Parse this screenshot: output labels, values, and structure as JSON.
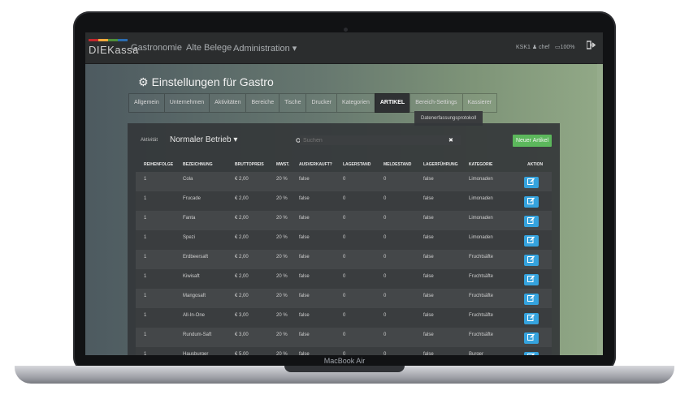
{
  "device": {
    "label": "MacBook Air"
  },
  "navbar": {
    "logo": "DIEKassa",
    "logo_colors": [
      "#c2272d",
      "#f2a93b",
      "#4e8f3a",
      "#2b6cb0"
    ],
    "items": [
      "Gastronomie",
      "Alte Belege",
      "Administration ▾"
    ],
    "user": "KSK1 ♟ chef",
    "battery": "▭100%",
    "logout_icon": "logout-icon"
  },
  "page": {
    "title": "Einstellungen für Gastro"
  },
  "tabs": [
    {
      "label": "Allgemein"
    },
    {
      "label": "Unternehmen"
    },
    {
      "label": "Aktivitäten"
    },
    {
      "label": "Bereiche"
    },
    {
      "label": "Tische"
    },
    {
      "label": "Drucker"
    },
    {
      "label": "Kategorien"
    },
    {
      "label": "ARTIKEL"
    },
    {
      "label": "Bereich-Settings"
    },
    {
      "label": "Kassierer"
    }
  ],
  "subtab": "Datenerfassungsprotokoll",
  "toolbar": {
    "activity_label": "Aktivität",
    "activity_value": "Normaler Betrieb ▾",
    "search_label": "Suchen",
    "clear_icon": "✖",
    "new_button": "Neuer Artikel"
  },
  "table": {
    "headers": [
      "REIHENFOLGE",
      "BEZEICHNUNG",
      "BRUTTOPREIS",
      "MWST.",
      "AUSVERKAUFT?",
      "LAGERSTAND",
      "MELDESTAND",
      "LAGERFÜHRUNG",
      "KATEGORIE",
      "AKTION"
    ],
    "rows": [
      [
        "1",
        "Cola",
        "€ 2,00",
        "20 %",
        "false",
        "0",
        "0",
        "false",
        "Limonaden"
      ],
      [
        "1",
        "Frucade",
        "€ 2,00",
        "20 %",
        "false",
        "0",
        "0",
        "false",
        "Limonaden"
      ],
      [
        "1",
        "Fanta",
        "€ 2,00",
        "20 %",
        "false",
        "0",
        "0",
        "false",
        "Limonaden"
      ],
      [
        "1",
        "Spezi",
        "€ 2,00",
        "20 %",
        "false",
        "0",
        "0",
        "false",
        "Limonaden"
      ],
      [
        "1",
        "Erdbeersaft",
        "€ 2,00",
        "20 %",
        "false",
        "0",
        "0",
        "false",
        "Fruchtsäfte"
      ],
      [
        "1",
        "Kiwisaft",
        "€ 2,00",
        "20 %",
        "false",
        "0",
        "0",
        "false",
        "Fruchtsäfte"
      ],
      [
        "1",
        "Mangosaft",
        "€ 2,00",
        "20 %",
        "false",
        "0",
        "0",
        "false",
        "Fruchtsäfte"
      ],
      [
        "1",
        "All-In-One",
        "€ 3,00",
        "20 %",
        "false",
        "0",
        "0",
        "false",
        "Fruchtsäfte"
      ],
      [
        "1",
        "Rundum-Saft",
        "€ 3,00",
        "20 %",
        "false",
        "0",
        "0",
        "false",
        "Fruchtsäfte"
      ],
      [
        "1",
        "Hausburger",
        "€ 5,00",
        "20 %",
        "false",
        "0",
        "0",
        "false",
        "Burger"
      ]
    ],
    "edit_icon": "edit-icon"
  },
  "colors": {
    "new_button": "#5cb85c",
    "edit_button": "#35a3de",
    "active_tab": "#2f3133"
  }
}
